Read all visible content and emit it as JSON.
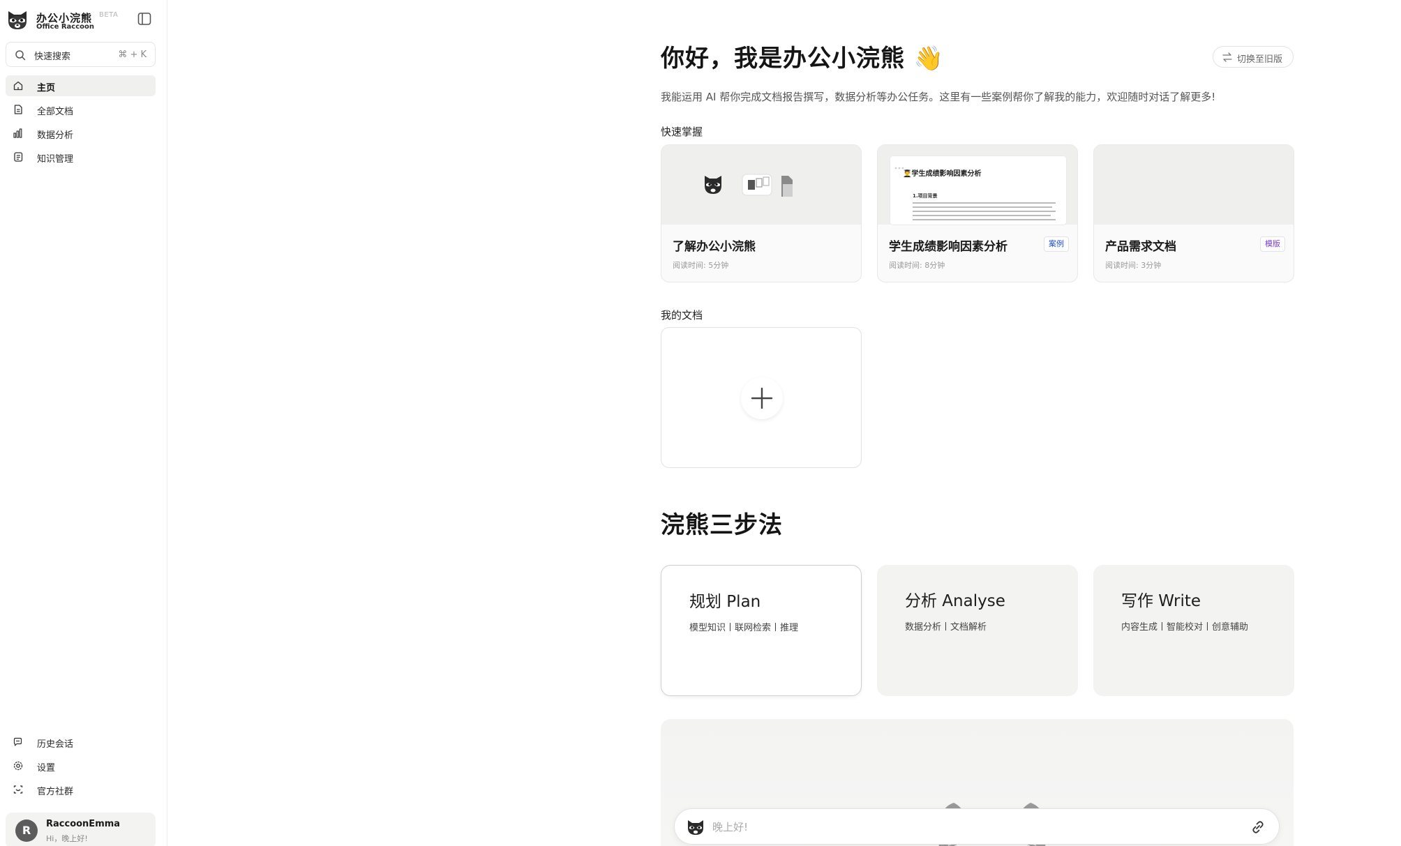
{
  "brand": {
    "title": "办公小浣熊",
    "beta": "BETA",
    "subtitle": "Office Raccoon"
  },
  "search": {
    "label": "快速搜索",
    "shortcut": "⌘ + K"
  },
  "nav": [
    {
      "label": "主页",
      "icon": "home-icon"
    },
    {
      "label": "全部文档",
      "icon": "document-icon"
    },
    {
      "label": "数据分析",
      "icon": "bar-chart-icon"
    },
    {
      "label": "知识管理",
      "icon": "notebook-icon"
    }
  ],
  "bottom_nav": [
    {
      "label": "历史会话",
      "icon": "chat-history-icon"
    },
    {
      "label": "设置",
      "icon": "gear-icon"
    },
    {
      "label": "官方社群",
      "icon": "community-icon"
    }
  ],
  "user": {
    "initial": "R",
    "name": "RaccoonEmma",
    "greeting": "Hi，晚上好!"
  },
  "header": {
    "greeting": "你好，我是办公小浣熊",
    "wave": "👋",
    "switch_old": "切换至旧版",
    "intro": "我能运用 AI 帮你完成文档报告撰写，数据分析等办公任务。这里有一些案例帮你了解我的能力，欢迎随时对话了解更多!"
  },
  "quick": {
    "label": "快速掌握",
    "cards": [
      {
        "title": "了解办公小浣熊",
        "time": "阅读时间: 5分钟",
        "badge": ""
      },
      {
        "title": "学生成绩影响因素分析",
        "time": "阅读时间: 8分钟",
        "badge": "案例",
        "badge_color": "#1f4fbf"
      },
      {
        "title": "产品需求文档",
        "time": "阅读时间: 3分钟",
        "badge": "模版",
        "badge_color": "#7b3fd6"
      }
    ],
    "preview": {
      "title": "👨‍🎓学生成绩影响因素分析",
      "heading": "1.项目背景"
    }
  },
  "my_docs": {
    "label": "我的文档"
  },
  "steps": {
    "title": "浣熊三步法",
    "items": [
      {
        "title": "规划 Plan",
        "sub": "模型知识丨联网检索丨推理"
      },
      {
        "title": "分析 Analyse",
        "sub": "数据分析丨文档解析"
      },
      {
        "title": "写作 Write",
        "sub": "内容生成丨智能校对丨创意辅助"
      }
    ]
  },
  "chat": {
    "placeholder": "晚上好!"
  }
}
